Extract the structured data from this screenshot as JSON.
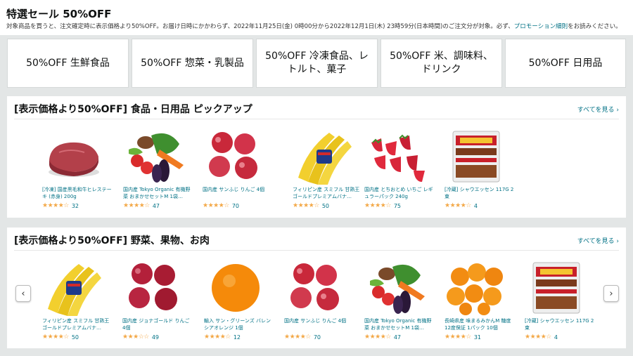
{
  "page": {
    "title": "特選セール 50%OFF",
    "notice_text": "対象商品を買うと、注文確定時に表示価格より50%OFF。お届け日時にかかわらず、2022年11月25日(金) 0時00分から2022年12月1日(木) 23時59分(日本時間)のご注文分が対象。必ず、",
    "notice_link": "プロモーション細則",
    "notice_suffix": "をお読みください。"
  },
  "categories": [
    {
      "label": "50%OFF 生鮮食品"
    },
    {
      "label": "50%OFF 惣菜・乳製品"
    },
    {
      "label": "50%OFF 冷凍食品、レトルト、菓子"
    },
    {
      "label": "50%OFF 米、調味料、ドリンク"
    },
    {
      "label": "50%OFF 日用品"
    }
  ],
  "section1": {
    "title": "[表示価格より50%OFF] 食品・日用品 ピックアップ",
    "see_all": "すべてを見る ›",
    "items": [
      {
        "name": "[冷凍] 国産黒毛和牛ヒレステーキ (赤身) 200g",
        "stars": "★★★★☆",
        "count": "32",
        "icon": "beef-steak"
      },
      {
        "name": "国内産 Tokyo Organic 有機野菜 おまかせセットM 1袋…",
        "stars": "★★★★☆",
        "count": "47",
        "icon": "vegetable-set"
      },
      {
        "name": "国内産 サンふじ りんご 4個",
        "stars": "★★★★☆",
        "count": "70",
        "icon": "apples"
      },
      {
        "name": "フィリピン産 スミフル 甘熟王ゴールドプレミアムバナ…",
        "stars": "★★★★☆",
        "count": "50",
        "icon": "bananas"
      },
      {
        "name": "国内産 とちおとめ いちご レギュラーパック 240g",
        "stars": "★★★★☆",
        "count": "75",
        "icon": "strawberries"
      },
      {
        "name": "[冷蔵] シャウエッセン 117G 2束",
        "stars": "★★★★☆",
        "count": "4",
        "icon": "sausage-pack"
      }
    ]
  },
  "section2": {
    "title": "[表示価格より50%OFF] 野菜、果物、お肉",
    "see_all": "すべてを見る ›",
    "prev": "‹",
    "next": "›",
    "items": [
      {
        "name": "フィリピン産 スミフル 甘熟王ゴールドプレミアムバナ…",
        "stars": "★★★★☆",
        "count": "50",
        "icon": "bananas"
      },
      {
        "name": "国内産 ジョナゴールド りんご 4個",
        "stars": "★★★☆☆",
        "count": "49",
        "icon": "apples"
      },
      {
        "name": "輸入 サン・グリーンズ バレンシアオレンジ 1個",
        "stars": "★★★★☆",
        "count": "12",
        "icon": "orange"
      },
      {
        "name": "国内産 サンふじ りんご 4個",
        "stars": "★★★★☆",
        "count": "70",
        "icon": "apples"
      },
      {
        "name": "国内産 Tokyo Organic 有機野菜 おまかせセットM 1袋…",
        "stars": "★★★★☆",
        "count": "47",
        "icon": "vegetable-set"
      },
      {
        "name": "長崎県産 味まるみかんM 糖度12度保証 1パック 10個",
        "stars": "★★★★☆",
        "count": "31",
        "icon": "mandarins"
      },
      {
        "name": "[冷蔵] シャウエッセン 117G 2束",
        "stars": "★★★★☆",
        "count": "4",
        "icon": "sausage-pack"
      }
    ]
  }
}
